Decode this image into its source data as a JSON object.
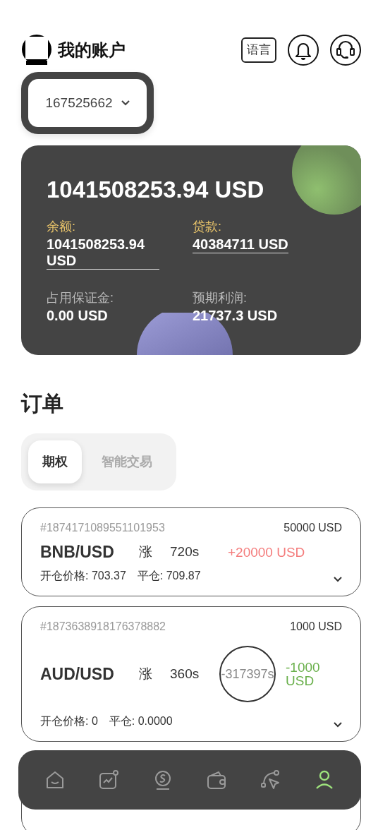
{
  "header": {
    "title": "我的账户",
    "language_button": "语言"
  },
  "account_selector": {
    "value": "167525662"
  },
  "balance_card": {
    "total": "1041508253.94 USD",
    "fields": [
      {
        "label": "余额:",
        "value": "1041508253.94 USD",
        "highlight": true
      },
      {
        "label": "贷款:",
        "value": "40384711 USD",
        "highlight": true
      },
      {
        "label": "占用保证金:",
        "value": "0.00 USD",
        "highlight": false
      },
      {
        "label": "预期利润:",
        "value": "21737.3 USD",
        "highlight": false
      }
    ]
  },
  "orders_title": "订单",
  "tabs": [
    {
      "label": "期权",
      "selected": true
    },
    {
      "label": "智能交易",
      "selected": false
    }
  ],
  "orders": [
    {
      "id": "#1874171089551101953",
      "amount": "50000 USD",
      "pair": "BNB/USD",
      "direction": "涨",
      "duration": "720s",
      "profit": "+20000 USD",
      "color": "#f47c7c",
      "open_price": "开仓价格: 703.37",
      "close_price": "平仓: 709.87"
    },
    {
      "id": "#1873638918176378882",
      "amount": "1000 USD",
      "pair": "AUD/USD",
      "direction": "涨",
      "duration": "360s",
      "countdown": "-317397s",
      "profit": "-1000 USD",
      "color": "#6ab04c",
      "open_price": "开仓价格: 0",
      "close_price": "平仓: 0.0000"
    },
    {
      "kind": "cut"
    }
  ],
  "bottom_nav": [
    {
      "selected": false
    },
    {
      "selected": false
    },
    {
      "selected": false
    },
    {
      "selected": false
    },
    {
      "selected": false
    },
    {
      "selected": true
    }
  ]
}
